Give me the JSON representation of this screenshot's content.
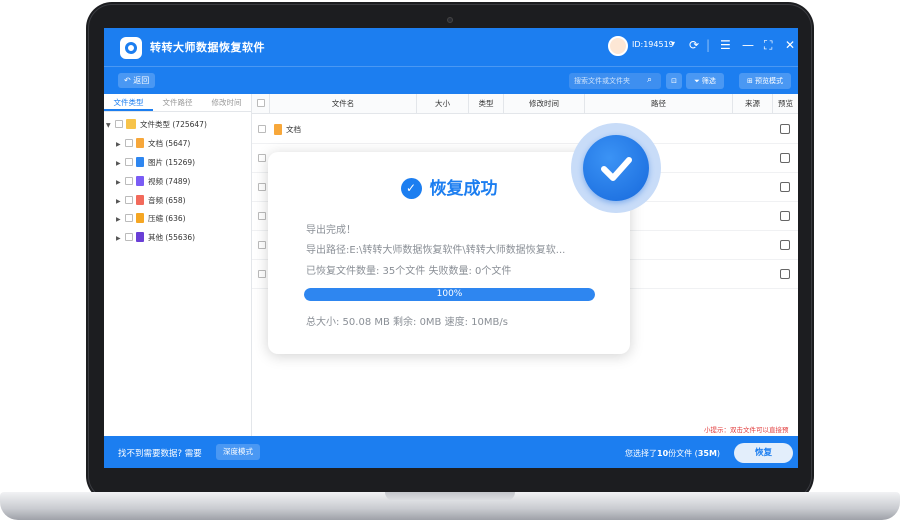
{
  "titlebar": {
    "app_title": "转转大师数据恢复软件",
    "user_id": "ID:194519",
    "icons": [
      "refresh-icon",
      "divider",
      "menu-icon",
      "minimize-icon",
      "maximize-icon",
      "close-icon"
    ]
  },
  "toolbar": {
    "back_label": "返回",
    "search_placeholder": "搜索文件或文件夹",
    "filter_label": "筛选",
    "preview_mode_label": "预览模式"
  },
  "left_panel": {
    "tabs": [
      "文件类型",
      "文件路径",
      "修改时间"
    ],
    "root": {
      "label": "文件类型 (725647)"
    },
    "categories": [
      {
        "label": "文档 (5647)",
        "color": "#f7a73a"
      },
      {
        "label": "图片 (15269)",
        "color": "#2e86f0"
      },
      {
        "label": "视频 (7489)",
        "color": "#7a5cf5"
      },
      {
        "label": "音频 (658)",
        "color": "#f26a5b"
      },
      {
        "label": "压缩 (636)",
        "color": "#f5a623"
      },
      {
        "label": "其他 (55636)",
        "color": "#6a3fd6"
      }
    ]
  },
  "table": {
    "headers": [
      "文件名",
      "大小",
      "类型",
      "修改时间",
      "路径",
      "来源",
      "预览"
    ],
    "rows": [
      {
        "name": "文档"
      }
    ],
    "tip": "小提示：双击文件可以直接预"
  },
  "bottombar": {
    "no_find_text": "找不到需要数据? 需要",
    "deep_mode_label": "深度模式",
    "selected_prefix": "您选择了",
    "selected_count": "10",
    "selected_mid": "份文件 (",
    "selected_size": "35M",
    "selected_suffix": ")",
    "recover_label": "恢复"
  },
  "modal": {
    "title": "恢复成功",
    "export_done": "导出完成！",
    "export_path": "导出路径:E:\\转转大师数据恢复软件\\转转大师数据恢复软...",
    "counts": "已恢复文件数量:  35个文件   失败数量:  0个文件",
    "progress_percent": 100,
    "progress_label": "100%",
    "stats": "总大小: 50.08 MB 剩余: 0MB 速度: 10MB/s"
  },
  "colors": {
    "brand_blue": "#1c7ef0",
    "tip_red": "#e23b3b"
  }
}
